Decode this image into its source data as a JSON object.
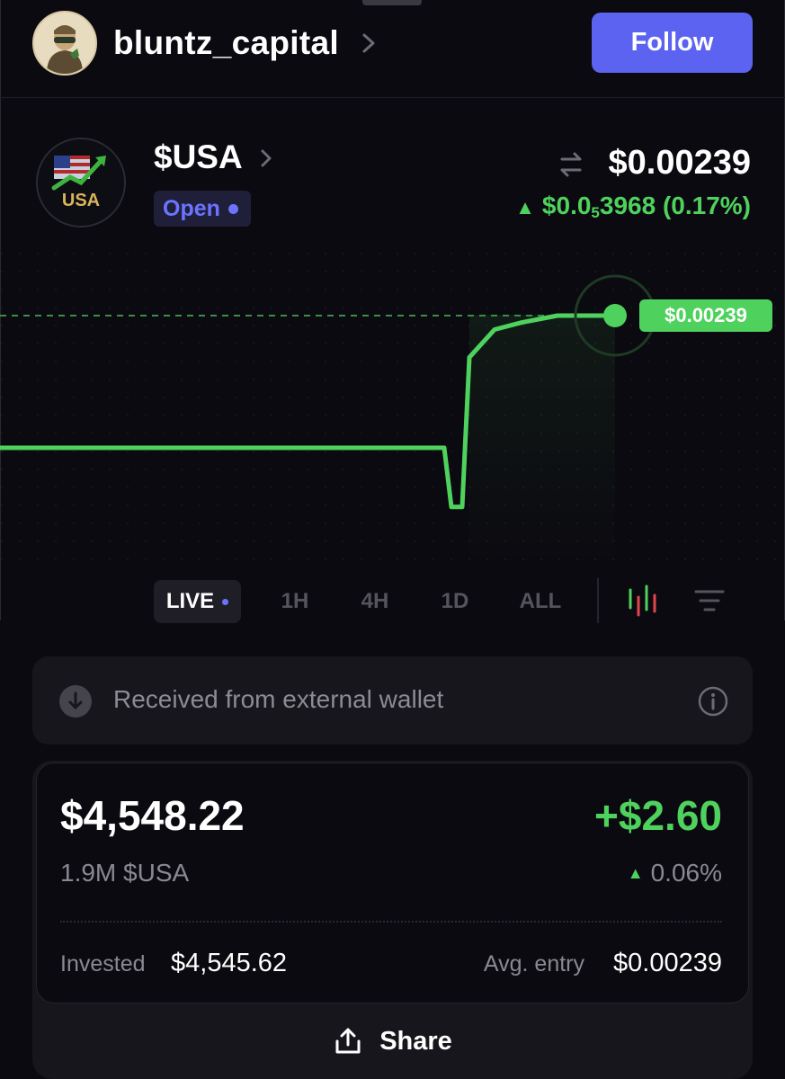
{
  "header": {
    "username": "bluntz_capital",
    "follow_label": "Follow",
    "avatar_icon": "avatar-icon"
  },
  "token": {
    "symbol": "$USA",
    "logo_text": "USA",
    "status": "Open",
    "price": "$0.00239",
    "change_prefix": "$0.0",
    "change_subscript": "5",
    "change_suffix": "3968 (0.17%)",
    "tag_price": "$0.00239"
  },
  "chart_data": {
    "type": "line",
    "series": [
      {
        "values": [
          0.0023862,
          0.0023862,
          0.0023862,
          0.0023862,
          0.0023862,
          0.0023862,
          0.0023862,
          0.0023862,
          0.0023862,
          0.0023862,
          0.0023862,
          0.0023862,
          0.0023862,
          0.0023845,
          0.0023845,
          0.0023888,
          0.0023896,
          0.0023898,
          0.00239,
          0.00239,
          0.00239
        ]
      }
    ],
    "current_price": 0.00239
  },
  "timeframes": {
    "live": "LIVE",
    "h1": "1H",
    "h4": "4H",
    "d1": "1D",
    "all": "ALL"
  },
  "notice": {
    "text": "Received from external wallet"
  },
  "position": {
    "value": "$4,548.22",
    "pnl": "+$2.60",
    "amount": "1.9M $USA",
    "pnl_pct": "0.06%",
    "invested_label": "Invested",
    "invested_value": "$4,545.62",
    "avg_label": "Avg. entry",
    "avg_value": "$0.00239"
  },
  "share": {
    "label": "Share"
  },
  "colors": {
    "accent": "#5b63f0",
    "green": "#4fd25d",
    "red": "#e0474c",
    "background": "#0b0a10"
  }
}
